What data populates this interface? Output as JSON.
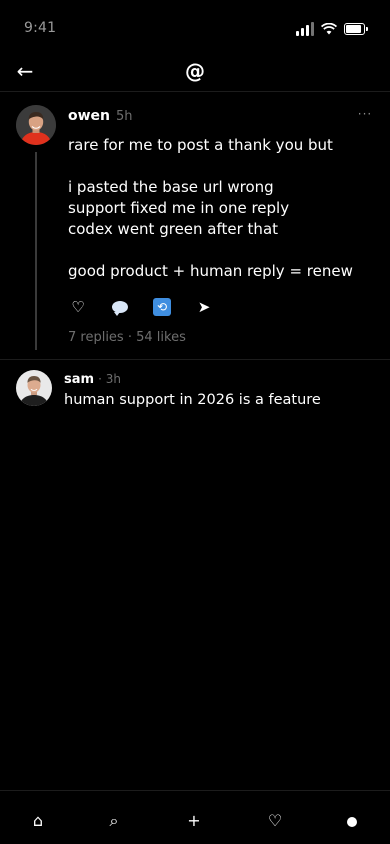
{
  "status_bar": {
    "time": "9:41"
  },
  "header": {
    "back_label": "←",
    "logo": "@"
  },
  "post": {
    "username": "owen",
    "timestamp": "5h",
    "more_label": "···",
    "lines": [
      "rare for me to post a thank you but",
      "",
      "i pasted the base url wrong",
      "support fixed me in one reply",
      "codex went green after that",
      "",
      "good product + human reply = renew"
    ],
    "actions": {
      "like_label": "♡",
      "repost_label": "⟲",
      "share_label": "➤"
    },
    "stats": "7 replies · 54 likes"
  },
  "reply": {
    "username": "sam",
    "timestamp": "· 3h",
    "text": "human support in 2026 is a feature"
  },
  "bottom_nav": {
    "home_label": "⌂",
    "search_label": "⌕",
    "add_label": "+",
    "activity_label": "♡"
  }
}
